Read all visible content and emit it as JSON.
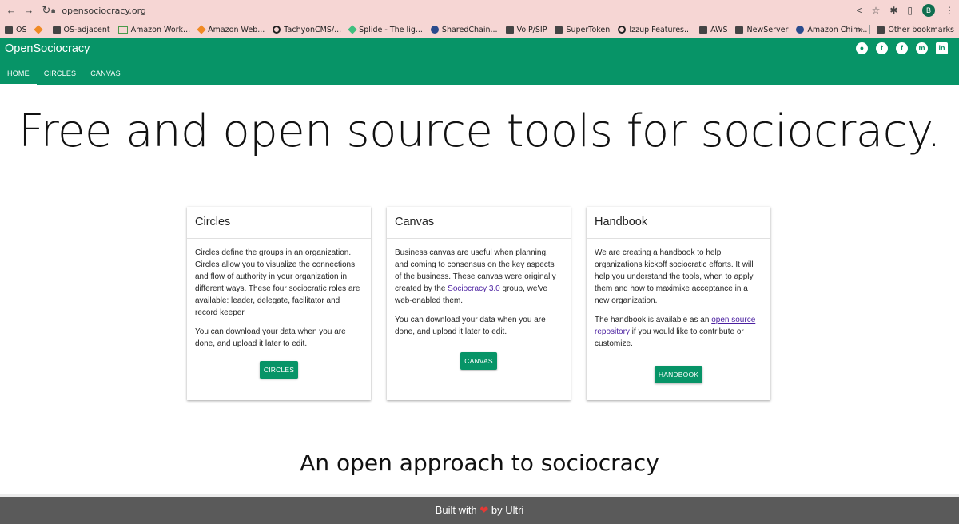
{
  "browser": {
    "url": "opensociocracy.org",
    "profile_initial": "B",
    "bookmarks": [
      {
        "label": "OS",
        "icon": "folder-icon"
      },
      {
        "label": "",
        "icon": "cube-icon"
      },
      {
        "label": "OS-adjacent",
        "icon": "folder-icon"
      },
      {
        "label": "Amazon Work...",
        "icon": "mail-icon"
      },
      {
        "label": "Amazon Web...",
        "icon": "cube-icon"
      },
      {
        "label": "TachyonCMS/...",
        "icon": "github-icon"
      },
      {
        "label": "Splide - The lig...",
        "icon": "diamond-icon"
      },
      {
        "label": "SharedChain...",
        "icon": "globe-icon"
      },
      {
        "label": "VoIP/SIP",
        "icon": "folder-icon"
      },
      {
        "label": "SuperToken",
        "icon": "folder-icon"
      },
      {
        "label": "Izzup Features...",
        "icon": "github-icon"
      },
      {
        "label": "AWS",
        "icon": "folder-icon"
      },
      {
        "label": "NewServer",
        "icon": "folder-icon"
      },
      {
        "label": "Amazon Chim...",
        "icon": "globe-icon"
      }
    ],
    "overflow": "»",
    "other_bookmarks": "Other bookmarks"
  },
  "app": {
    "title": "OpenSociocracy",
    "tabs": [
      {
        "label": "HOME"
      },
      {
        "label": "CIRCLES"
      },
      {
        "label": "CANVAS"
      }
    ],
    "social": [
      {
        "icon": "github-icon",
        "glyph": "●"
      },
      {
        "icon": "twitter-icon",
        "glyph": "t"
      },
      {
        "icon": "facebook-icon",
        "glyph": "f"
      },
      {
        "icon": "mastodon-icon",
        "glyph": "m"
      },
      {
        "icon": "linkedin-icon",
        "glyph": "in"
      }
    ]
  },
  "hero": "Free and open source tools for sociocracy.",
  "cards": [
    {
      "title": "Circles",
      "p1": "Circles define the groups in an organization. Circles allow you to visualize the connections and flow of authority in your organization in different ways. These four sociocratic roles are available: leader, delegate, facilitator and record keeper.",
      "p2": "You can download your data when you are done, and upload it later to edit.",
      "button": "CIRCLES"
    },
    {
      "title": "Canvas",
      "p1_before": "Business canvas are useful when planning, and coming to consensus on the key aspects of the business. These canvas were originally created by the ",
      "p1_link": "Sociocracy 3.0",
      "p1_after": " group, we've web-enabled them.",
      "p2": "You can download your data when you are done, and upload it later to edit.",
      "button": "CANVAS"
    },
    {
      "title": "Handbook",
      "p1": "We are creating a handbook to help organizations kickoff sociocratic efforts. It will help you understand the tools, when to apply them and how to maximixe acceptance in a new organization.",
      "p2_before": "The handbook is available as an ",
      "p2_link": "open source repository",
      "p2_after": " if you would like to contribute or customize.",
      "button": "HANDBOOK"
    }
  ],
  "subhead": "An open approach to sociocracy",
  "footer": {
    "before": "Built with",
    "heart": "❤",
    "after": "by Ultri"
  },
  "colors": {
    "brand_green": "#079467",
    "footer_gray": "#5a5a5a",
    "link_purple": "#4a1fa0",
    "heart_red": "#e53935"
  }
}
